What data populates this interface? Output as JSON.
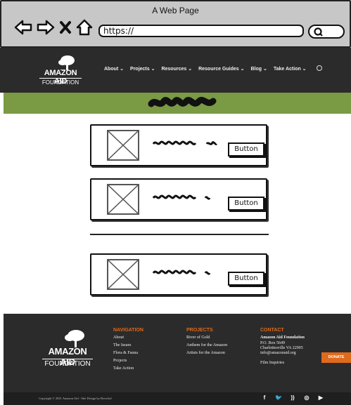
{
  "browser": {
    "window_title": "A Web Page",
    "url": "https://"
  },
  "header": {
    "logo_line1": "AMAZON AID",
    "logo_line2": "FOUNDATION",
    "nav": [
      "About ⌄",
      "Projects ⌄",
      "Resources ⌄",
      "Resource Guides ⌄",
      "Blog ⌄",
      "Take Action ⌄"
    ]
  },
  "cards": [
    {
      "button_label": "Button"
    },
    {
      "button_label": "Button"
    },
    {
      "button_label": "Button"
    }
  ],
  "footer": {
    "logo_line1": "AMAZON AID",
    "logo_line2": "FOUNDATION",
    "navigation": {
      "heading": "NAVIGATION",
      "items": [
        "About",
        "The Issues",
        "Flora & Fauna",
        "Projects",
        "Take Action"
      ]
    },
    "projects": {
      "heading": "PROJECTS",
      "items": [
        "River of Gold",
        "Anthem for the Amazon",
        "Artists for the Amazon"
      ]
    },
    "contact": {
      "heading": "CONTACT",
      "org": "Amazon Aid Foundation",
      "lines": [
        "P.O. Box 5649",
        "Charlottesville VA 22905",
        "info@amazonaid.org"
      ],
      "film": "Film Inquiries"
    },
    "donate_label": "DONATE",
    "copyright": "Copyright © 2021 Amazon Aid - Site Design by Brewlod",
    "social": [
      "f",
      "🐦",
      "))",
      "◎",
      "▶"
    ]
  },
  "colors": {
    "chrome_gray": "#c7c7c7",
    "header_dark": "#2b2b2b",
    "green_band": "#7a9a44",
    "accent_orange": "#e06a1b"
  }
}
